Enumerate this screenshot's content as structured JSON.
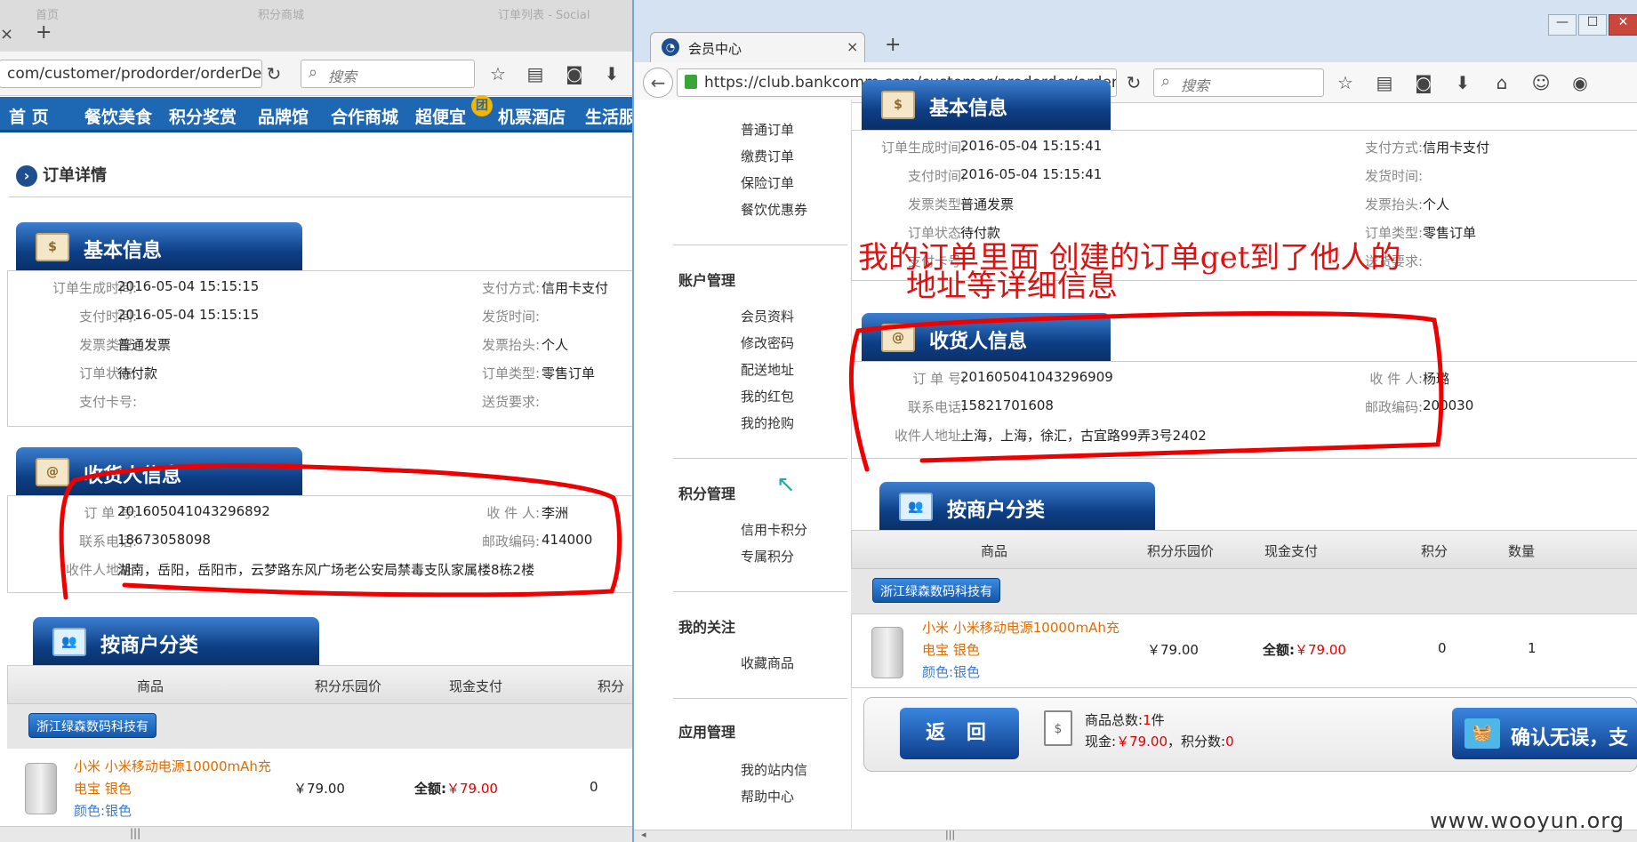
{
  "left": {
    "ghost_tabs": [
      "首页",
      "积分商城",
      "订单列表 - Social",
      "会员中心"
    ],
    "tab_close": "×",
    "new_tab": "+",
    "url": "com/customer/prodorder/orderDet",
    "search_placeholder": "搜索",
    "nav": [
      "首 页",
      "餐饮美食",
      "积分奖赏",
      "品牌馆",
      "合作商城",
      "超便宜",
      "机票酒店",
      "生活服"
    ],
    "nav_badge": "团",
    "breadcrumb": "订单详情",
    "basic": {
      "title": "基本信息",
      "icon_text": "$",
      "rows": [
        {
          "l1": "订单生成时间:",
          "v1": "2016-05-04 15:15:15",
          "l2": "支付方式:",
          "v2": "信用卡支付"
        },
        {
          "l1": "支付时间:",
          "v1": "2016-05-04 15:15:15",
          "l2": "发货时间:",
          "v2": ""
        },
        {
          "l1": "发票类型:",
          "v1": "普通发票",
          "l2": "发票抬头:",
          "v2": "个人"
        },
        {
          "l1": "订单状态:",
          "v1": "待付款",
          "l2": "订单类型:",
          "v2": "零售订单"
        },
        {
          "l1": "支付卡号:",
          "v1": "",
          "l2": "送货要求:",
          "v2": ""
        }
      ]
    },
    "recv": {
      "title": "收货人信息",
      "icon_text": "@",
      "order_no_label": "订 单 号:",
      "order_no": "201605041043296892",
      "receiver_label": "收 件 人:",
      "receiver": "李洲",
      "phone_label": "联系电话:",
      "phone": "18673058098",
      "zip_label": "邮政编码:",
      "zip": "414000",
      "addr_label": "收件人地址:",
      "addr": "湖南，岳阳，岳阳市，云梦路东风广场老公安局禁毒支队家属楼8栋2楼"
    },
    "merchant": {
      "title": "按商户分类",
      "cols": [
        "商品",
        "积分乐园价",
        "现金支付",
        "积分"
      ],
      "shop": "浙江绿森数码科技有",
      "product_line1": "小米 小米移动电源10000mAh充",
      "product_line2": "电宝 银色",
      "product_line3": "颜色:银色",
      "price": "￥79.00",
      "total_label": "全额:",
      "total": "￥79.00",
      "points": "0"
    },
    "scroll_grip": "|||"
  },
  "right": {
    "tab_title": "会员中心",
    "tab_close": "×",
    "new_tab": "+",
    "url": "https://club.bankcomm.com/customer/prodorder/orderDet",
    "search_placeholder": "搜索",
    "win_controls": [
      "—",
      "☐",
      "✕"
    ],
    "sidebar": {
      "group0_items": [
        "普通订单",
        "缴费订单",
        "保险订单",
        "餐饮优惠券"
      ],
      "groups": [
        {
          "title": "账户管理",
          "items": [
            "会员资料",
            "修改密码",
            "配送地址",
            "我的红包",
            "我的抢购"
          ]
        },
        {
          "title": "积分管理",
          "items": [
            "信用卡积分",
            "专属积分"
          ]
        },
        {
          "title": "我的关注",
          "items": [
            "收藏商品"
          ]
        },
        {
          "title": "应用管理",
          "items": [
            "我的站内信",
            "帮助中心"
          ]
        }
      ]
    },
    "basic": {
      "title": "基本信息",
      "icon_text": "$",
      "rows": [
        {
          "l1": "订单生成时间:",
          "v1": "2016-05-04 15:15:41",
          "l2": "支付方式:",
          "v2": "信用卡支付"
        },
        {
          "l1": "支付时间:",
          "v1": "2016-05-04 15:15:41",
          "l2": "发货时间:",
          "v2": ""
        },
        {
          "l1": "发票类型:",
          "v1": "普通发票",
          "l2": "发票抬头:",
          "v2": "个人"
        },
        {
          "l1": "订单状态:",
          "v1": "待付款",
          "l2": "订单类型:",
          "v2": "零售订单"
        },
        {
          "l1": "支付卡号:",
          "v1": "",
          "l2": "送货要求:",
          "v2": ""
        }
      ]
    },
    "recv": {
      "title": "收货人信息",
      "icon_text": "@",
      "order_no_label": "订 单 号:",
      "order_no": "201605041043296909",
      "receiver_label": "收 件 人:",
      "receiver": "杨璐",
      "phone_label": "联系电话:",
      "phone": "15821701608",
      "zip_label": "邮政编码:",
      "zip": "200030",
      "addr_label": "收件人地址:",
      "addr": "上海，上海，徐汇，古宜路99弄3号2402"
    },
    "merchant": {
      "title": "按商户分类",
      "cols": [
        "商品",
        "积分乐园价",
        "现金支付",
        "积分",
        "数量"
      ],
      "shop": "浙江绿森数码科技有",
      "product_line1": "小米 小米移动电源10000mAh充",
      "product_line2": "电宝 银色",
      "product_line3": "颜色:银色",
      "price": "￥79.00",
      "total_label": "全额:",
      "total": "￥79.00",
      "points": "0",
      "qty": "1"
    },
    "footer": {
      "back": "返 回",
      "count_label": "商品总数:",
      "count": "1",
      "count_unit": "件",
      "cash_label": "现金:",
      "cash": "￥79.00",
      "points_label": "，积分数:",
      "points": "0",
      "confirm": "确认无误，支"
    },
    "annotation_line1": "我的订单里面 创建的订单get到了他人的",
    "annotation_line2": "地址等详细信息",
    "watermark": "www.wooyun.org",
    "scroll_grip": "|||"
  },
  "colors": {
    "site_nav": "#1d67b3",
    "section_head": "#0d3f86",
    "annotation": "#e01010",
    "price_red": "#e00000",
    "product_orange": "#e26b00"
  }
}
